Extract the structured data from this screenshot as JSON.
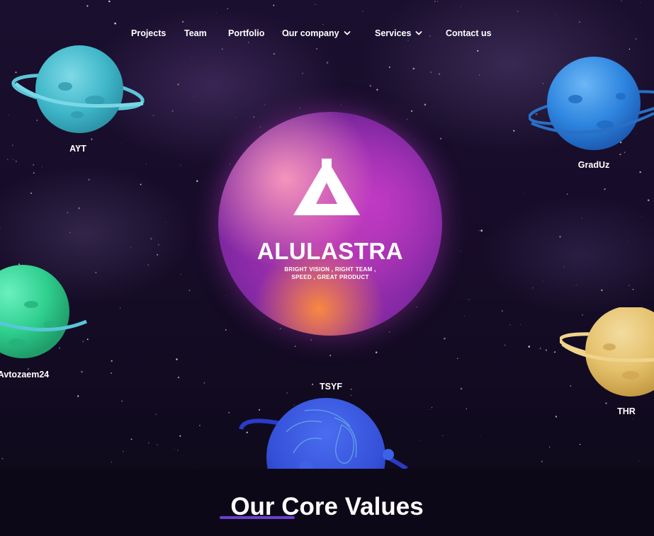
{
  "nav": {
    "items": [
      {
        "label": "Projects"
      },
      {
        "label": "Team"
      },
      {
        "label": "Portfolio"
      },
      {
        "label": "Our company",
        "icon": "chevron-down-icon"
      },
      {
        "label": "Services",
        "icon": "chevron-down-icon"
      },
      {
        "label": "Contact us"
      }
    ]
  },
  "hero": {
    "brand": "ALULASTRA",
    "tagline_line1": "BRIGHT VISION , RIGHT TEAM ,",
    "tagline_line2": "SPEED , GREAT PRODUCT"
  },
  "planets": [
    {
      "label": "AYT",
      "color": "#3fb7c9"
    },
    {
      "label": "GradUz",
      "color": "#2f86e0"
    },
    {
      "label": "Avtozaem24",
      "color": "#2fcf8e"
    },
    {
      "label": "TSYF",
      "color": "#3450d8"
    },
    {
      "label": "THR",
      "color": "#e4c06a"
    }
  ],
  "values": {
    "title": "Our Core Values",
    "accent_color": "#6b3fd1"
  }
}
